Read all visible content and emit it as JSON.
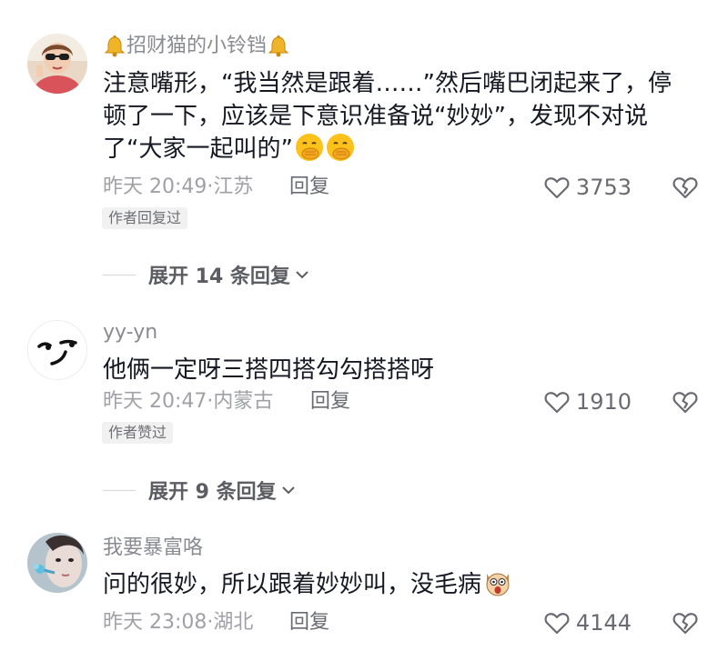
{
  "comments": [
    {
      "username": "招财猫的小铃铛",
      "avatar": "avatar-sunglasses-photo",
      "decoration_icon": "bell-icon",
      "text": "注意嘴形，“我当然是跟着……”然后嘴巴闭起来了，停顿了一下，应该是下意识准备说“妙妙”，发现不对说了“大家一起叫的”",
      "emoji": [
        "hand-over-mouth-emoji",
        "hand-over-mouth-emoji"
      ],
      "time": "昨天 20:49·江苏",
      "reply_label": "回复",
      "likes": "3753",
      "badge": "作者回复过",
      "expand_label": "展开 14 条回复"
    },
    {
      "username": "yy-yn",
      "avatar": "avatar-smirk-face",
      "text": "他俩一定呀三搭四搭勾勾搭搭呀",
      "time": "昨天 20:47·内蒙古",
      "reply_label": "回复",
      "likes": "1910",
      "badge": "作者赞过",
      "expand_label": "展开 9 条回复"
    },
    {
      "username": "我要暴富咯",
      "avatar": "avatar-flower-portrait",
      "text": "问的很妙，所以跟着妙妙叫，没毛病",
      "emoji": [
        "shocked-dog-emoji"
      ],
      "time": "昨天 23:08·湖北",
      "reply_label": "回复",
      "likes": "4144"
    }
  ],
  "colors": {
    "text": "#161823",
    "secondary": "#a0a1a6",
    "badge_bg": "#f1f1f2"
  }
}
